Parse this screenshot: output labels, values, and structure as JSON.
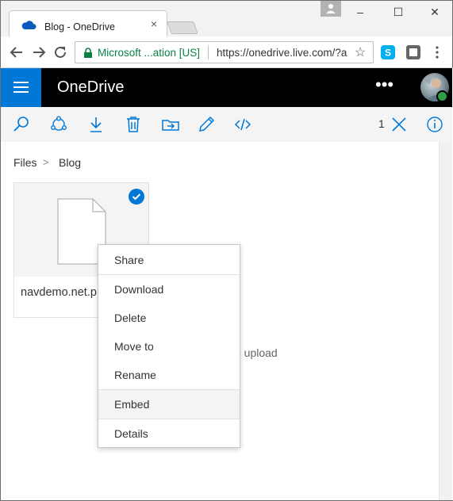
{
  "browser": {
    "tab_title": "Blog - OneDrive",
    "tab_close": "×",
    "secure_label": "Microsoft ...ation [US]",
    "url": "https://onedrive.live.com/?a",
    "window_controls": {
      "minimize": "–",
      "maximize": "☐",
      "close": "✕"
    }
  },
  "header": {
    "brand": "OneDrive",
    "more_label": "•••"
  },
  "commandbar": {
    "selection_count": "1",
    "icons": [
      "search-icon",
      "share-icon",
      "download-icon",
      "delete-icon",
      "move-to-icon",
      "rename-icon",
      "embed-icon",
      "clear-selection-icon",
      "info-icon"
    ]
  },
  "breadcrumb": {
    "items": [
      "Files",
      "Blog"
    ],
    "separator": ">"
  },
  "file": {
    "name": "navdemo.net.p",
    "selected": true
  },
  "upload_hint": "o upload",
  "context_menu": {
    "items": [
      {
        "label": "Share"
      },
      {
        "label": "Download"
      },
      {
        "label": "Delete"
      },
      {
        "label": "Move to"
      },
      {
        "label": "Rename"
      },
      {
        "label": "Embed"
      },
      {
        "label": "Details"
      }
    ],
    "hovered": "Embed"
  },
  "colors": {
    "accent": "#0078d7",
    "header_bg": "#000000",
    "secure_green": "#0b8043",
    "commandbar_bg": "#f4f4f4"
  }
}
